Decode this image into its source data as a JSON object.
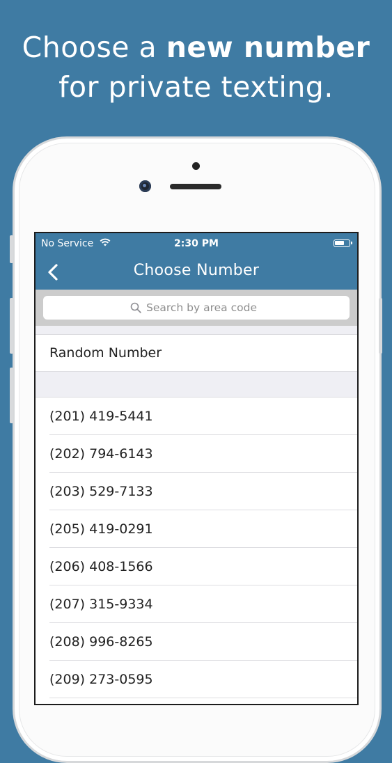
{
  "headline": {
    "line1_normal": "Choose a ",
    "line1_bold": "new number",
    "line2": "for private texting."
  },
  "colors": {
    "background": "#3f7ba3",
    "navbar": "#3f7ba3",
    "section_gray": "#efeff4"
  },
  "statusbar": {
    "carrier": "No Service",
    "time": "2:30 PM",
    "wifi_icon": "wifi-icon",
    "battery_icon": "battery-icon"
  },
  "navbar": {
    "back_icon": "chevron-left-icon",
    "title": "Choose Number"
  },
  "search": {
    "icon": "search-icon",
    "placeholder": "Search by area code"
  },
  "random_row": {
    "label": "Random Number"
  },
  "numbers": [
    "(201) 419-5441",
    "(202) 794-6143",
    "(203) 529-7133",
    "(205) 419-0291",
    "(206) 408-1566",
    "(207) 315-9334",
    "(208) 996-8265",
    "(209) 273-0595"
  ]
}
